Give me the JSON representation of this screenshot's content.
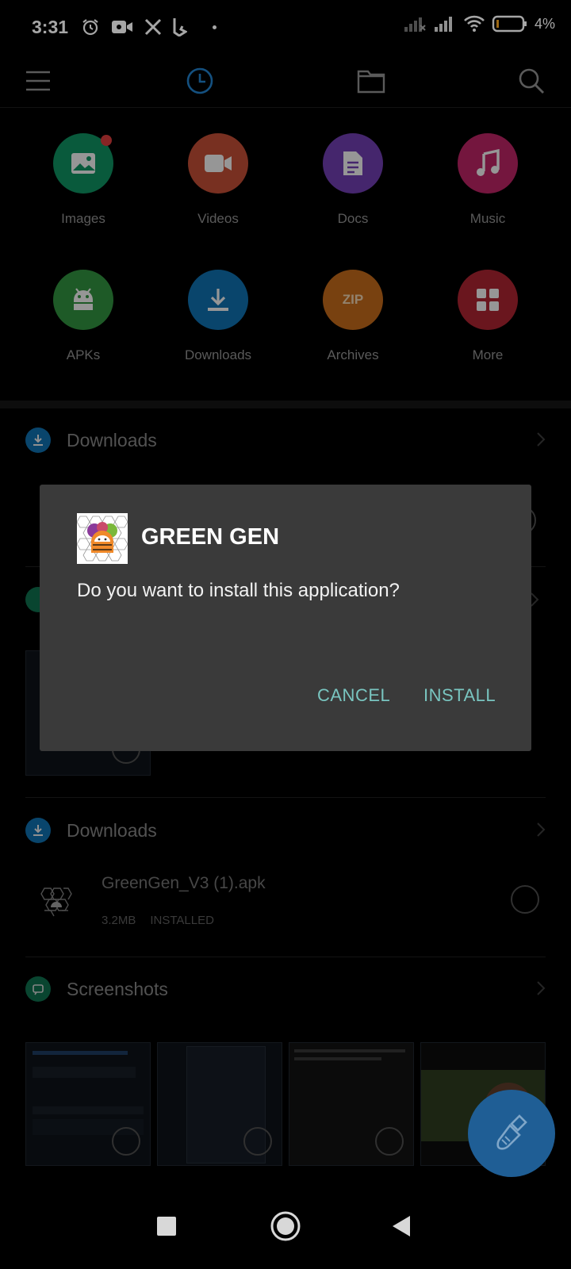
{
  "status_bar": {
    "time": "3:31",
    "battery": "4%",
    "icons": [
      "alarm-icon",
      "video-record-icon",
      "x-app-icon",
      "bing-icon",
      "dot-icon",
      "signal-off-icon",
      "signal-icon",
      "wifi-icon",
      "battery-icon"
    ]
  },
  "toolbar": {
    "icons": [
      "menu-icon",
      "recent-icon",
      "folder-icon",
      "search-icon"
    ],
    "accent": "#1f7bc4"
  },
  "categories": [
    {
      "label": "Images",
      "color": "#0f8a5c",
      "icon": "image-icon",
      "badge": true
    },
    {
      "label": "Videos",
      "color": "#b84a33",
      "icon": "video-icon"
    },
    {
      "label": "Docs",
      "color": "#6a3ba8",
      "icon": "doc-icon"
    },
    {
      "label": "Music",
      "color": "#b32260",
      "icon": "music-icon"
    },
    {
      "label": "APKs",
      "color": "#2f8a3c",
      "icon": "android-icon"
    },
    {
      "label": "Downloads",
      "color": "#0f6aa6",
      "icon": "download-icon"
    },
    {
      "label": "Archives",
      "color": "#b8641a",
      "icon": "zip-icon",
      "icon_text": "ZIP"
    },
    {
      "label": "More",
      "color": "#a4232f",
      "icon": "grid-icon"
    }
  ],
  "sections": {
    "downloads_1": {
      "title": "Downloads"
    },
    "downloads_2": {
      "title": "Downloads"
    },
    "screenshots": {
      "title": "Screenshots"
    }
  },
  "file": {
    "name": "GreenGen_V3 (1).apk",
    "size": "3.2MB",
    "status": "INSTALLED"
  },
  "dialog": {
    "app_name": "GREEN GEN",
    "message": "Do you want to install this application?",
    "cancel_label": "CANCEL",
    "install_label": "INSTALL",
    "button_color": "#79c5c0"
  }
}
